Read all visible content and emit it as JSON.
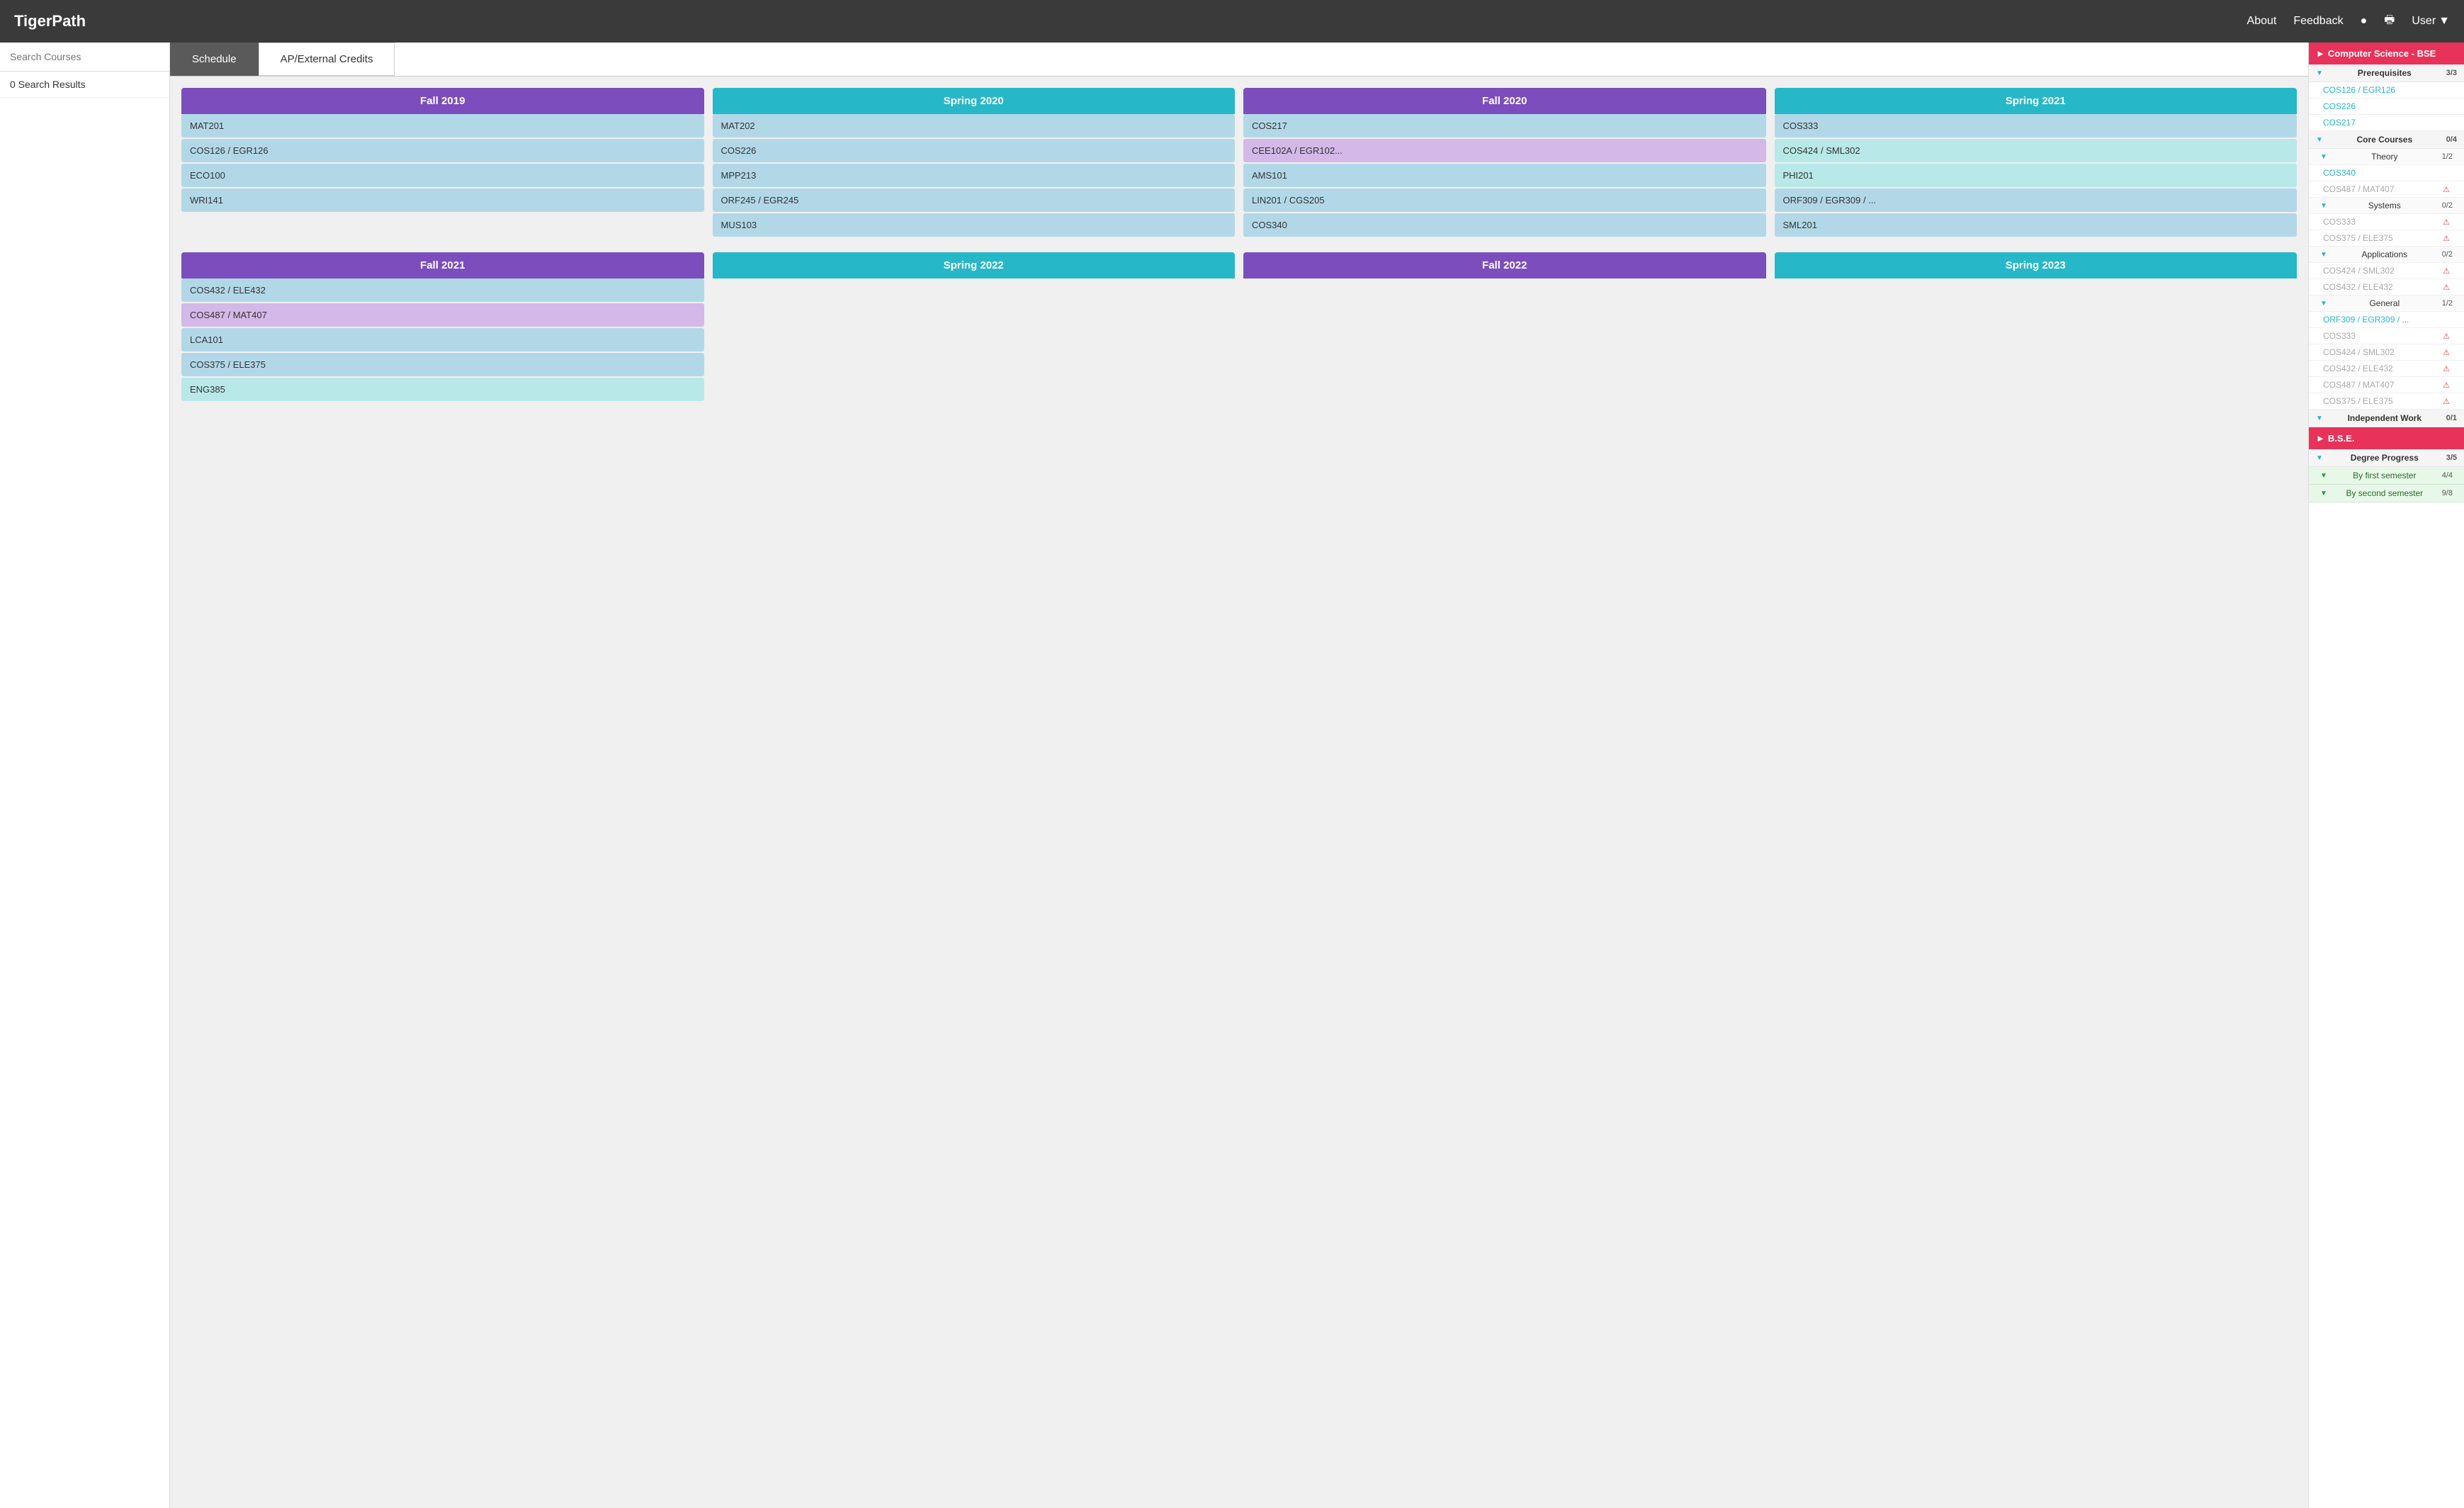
{
  "navbar": {
    "brand": "TigerPath",
    "links": {
      "about": "About",
      "feedback": "Feedback",
      "user": "User"
    }
  },
  "search": {
    "placeholder": "Search Courses",
    "results_count": "0 Search Results"
  },
  "tabs": [
    {
      "id": "schedule",
      "label": "Schedule",
      "active": true
    },
    {
      "id": "ap_credits",
      "label": "AP/External Credits",
      "active": false
    }
  ],
  "schedule": {
    "rows": [
      {
        "semesters": [
          {
            "id": "fall2019",
            "label": "Fall 2019",
            "color": "purple",
            "courses": [
              {
                "code": "MAT201",
                "color": "light-blue"
              },
              {
                "code": "COS126 / EGR126",
                "color": "light-blue"
              },
              {
                "code": "ECO100",
                "color": "light-blue"
              },
              {
                "code": "WRI141",
                "color": "light-blue"
              }
            ]
          },
          {
            "id": "spring2020",
            "label": "Spring 2020",
            "color": "teal",
            "courses": [
              {
                "code": "MAT202",
                "color": "light-blue"
              },
              {
                "code": "COS226",
                "color": "light-blue"
              },
              {
                "code": "MPP213",
                "color": "light-blue"
              },
              {
                "code": "ORF245 / EGR245",
                "color": "light-blue"
              },
              {
                "code": "MUS103",
                "color": "light-blue"
              }
            ]
          },
          {
            "id": "fall2020",
            "label": "Fall 2020",
            "color": "purple",
            "courses": [
              {
                "code": "COS217",
                "color": "light-blue"
              },
              {
                "code": "CEE102A / EGR102...",
                "color": "light-purple"
              },
              {
                "code": "AMS101",
                "color": "light-blue"
              },
              {
                "code": "LIN201 / CGS205",
                "color": "light-blue"
              },
              {
                "code": "COS340",
                "color": "light-blue"
              }
            ]
          },
          {
            "id": "spring2021",
            "label": "Spring 2021",
            "color": "teal",
            "courses": [
              {
                "code": "COS333",
                "color": "light-blue"
              },
              {
                "code": "COS424 / SML302",
                "color": "light-teal"
              },
              {
                "code": "PHI201",
                "color": "light-teal"
              },
              {
                "code": "ORF309 / EGR309 / ...",
                "color": "light-blue"
              },
              {
                "code": "SML201",
                "color": "light-blue"
              }
            ]
          }
        ]
      },
      {
        "semesters": [
          {
            "id": "fall2021",
            "label": "Fall 2021",
            "color": "purple",
            "courses": [
              {
                "code": "COS432 / ELE432",
                "color": "light-blue"
              },
              {
                "code": "COS487 / MAT407",
                "color": "light-purple"
              },
              {
                "code": "LCA101",
                "color": "light-blue"
              },
              {
                "code": "COS375 / ELE375",
                "color": "light-blue"
              },
              {
                "code": "ENG385",
                "color": "light-teal"
              }
            ]
          },
          {
            "id": "spring2022",
            "label": "Spring 2022",
            "color": "teal",
            "courses": []
          },
          {
            "id": "fall2022",
            "label": "Fall 2022",
            "color": "purple",
            "courses": []
          },
          {
            "id": "spring2023",
            "label": "Spring 2023",
            "color": "teal",
            "courses": []
          }
        ]
      }
    ]
  },
  "requirements": {
    "cs_bse": {
      "label": "Computer Science - BSE",
      "sections": [
        {
          "id": "prerequisites",
          "label": "Prerequisites",
          "count": "3/3",
          "courses": [
            {
              "code": "COS126 / EGR126",
              "satisfied": true
            },
            {
              "code": "COS226",
              "satisfied": true
            },
            {
              "code": "COS217",
              "satisfied": true
            }
          ]
        },
        {
          "id": "core",
          "label": "Core Courses",
          "count": "0/4",
          "subcategories": [
            {
              "id": "theory",
              "label": "Theory",
              "count": "1/2",
              "courses": [
                {
                  "code": "COS340",
                  "satisfied": true
                },
                {
                  "code": "COS487 / MAT407",
                  "satisfied": false,
                  "warn": true
                }
              ]
            },
            {
              "id": "systems",
              "label": "Systems",
              "count": "0/2",
              "courses": [
                {
                  "code": "COS333",
                  "satisfied": false,
                  "warn": true
                },
                {
                  "code": "COS375 / ELE375",
                  "satisfied": false,
                  "warn": true
                }
              ]
            },
            {
              "id": "applications",
              "label": "Applications",
              "count": "0/2",
              "courses": [
                {
                  "code": "COS424 / SML302",
                  "satisfied": false,
                  "warn": true
                },
                {
                  "code": "COS432 / ELE432",
                  "satisfied": false,
                  "warn": true
                }
              ]
            },
            {
              "id": "general",
              "label": "General",
              "count": "1/2",
              "courses": [
                {
                  "code": "ORF309 / EGR309 / ...",
                  "satisfied": true
                },
                {
                  "code": "COS333",
                  "satisfied": false,
                  "warn": true
                },
                {
                  "code": "COS424 / SML302",
                  "satisfied": false,
                  "warn": true
                },
                {
                  "code": "COS432 / ELE432",
                  "satisfied": false,
                  "warn": true
                },
                {
                  "code": "COS487 / MAT407",
                  "satisfied": false,
                  "warn": true
                },
                {
                  "code": "COS375 / ELE375",
                  "satisfied": false,
                  "warn": true
                }
              ]
            }
          ]
        },
        {
          "id": "independent_work",
          "label": "Independent Work",
          "count": "0/1"
        }
      ]
    },
    "bse": {
      "label": "B.S.E.",
      "sections": [
        {
          "id": "degree_progress",
          "label": "Degree Progress",
          "count": "3/5",
          "subsections": [
            {
              "label": "By first semester",
              "count": "4/4",
              "satisfied": true
            },
            {
              "label": "By second semester",
              "count": "9/8",
              "satisfied": true
            }
          ]
        }
      ]
    }
  }
}
